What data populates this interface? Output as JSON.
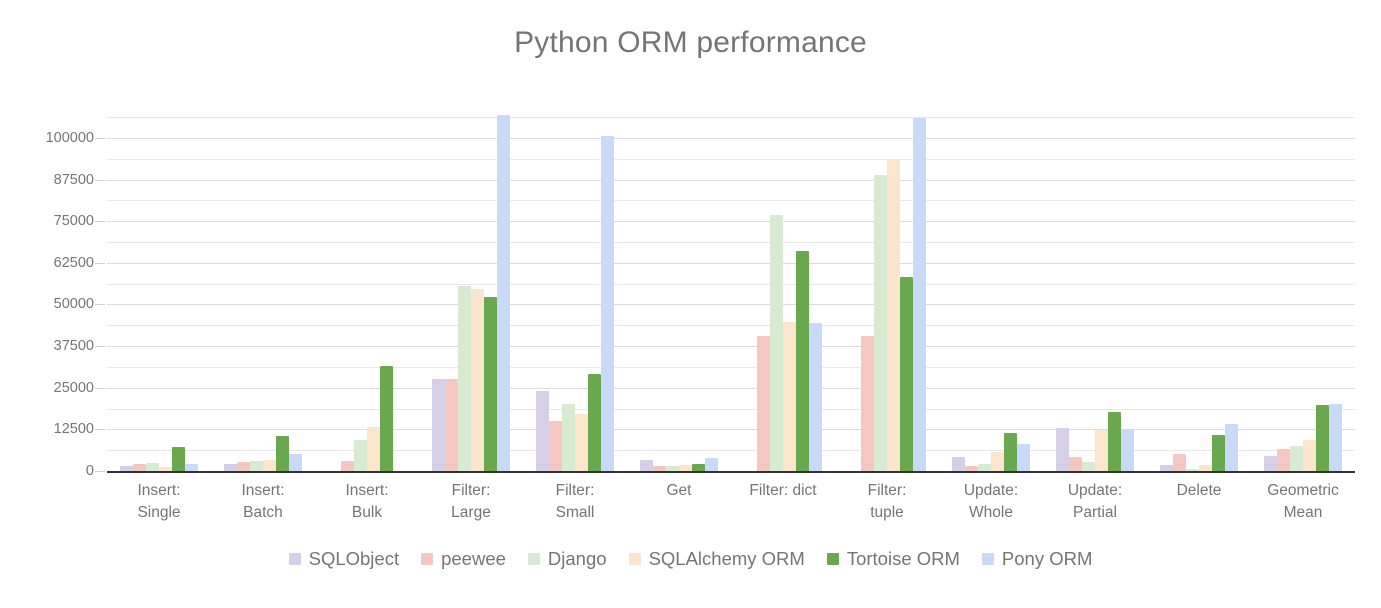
{
  "chart_data": {
    "type": "bar",
    "title": "Python ORM performance",
    "xlabel": "",
    "ylabel": "",
    "ylim": [
      0,
      112000
    ],
    "grid": true,
    "legend_position": "bottom",
    "y_ticks": [
      0,
      12500,
      25000,
      37500,
      50000,
      62500,
      75000,
      87500,
      100000
    ],
    "y_tick_labels": [
      "0",
      "12500",
      "25000",
      "37500",
      "50000",
      "62500",
      "75000",
      "87500",
      "100000"
    ],
    "y_minor_ticks": [
      6250,
      18750,
      31250,
      43750,
      56250,
      68750,
      81250,
      93750,
      106250
    ],
    "categories": [
      "Insert:\nSingle",
      "Insert:\nBatch",
      "Insert:\nBulk",
      "Filter:\nLarge",
      "Filter:\nSmall",
      "Get",
      "Filter: dict",
      "Filter:\ntuple",
      "Update:\nWhole",
      "Update:\nPartial",
      "Delete",
      "Geometric\nMean"
    ],
    "category_lines": [
      [
        "Insert:",
        "Single"
      ],
      [
        "Insert:",
        "Batch"
      ],
      [
        "Insert:",
        "Bulk"
      ],
      [
        "Filter:",
        "Large"
      ],
      [
        "Filter:",
        "Small"
      ],
      [
        "Get",
        ""
      ],
      [
        "Filter: dict",
        ""
      ],
      [
        "Filter:",
        "tuple"
      ],
      [
        "Update:",
        "Whole"
      ],
      [
        "Update:",
        "Partial"
      ],
      [
        "Delete",
        ""
      ],
      [
        "Geometric",
        "Mean"
      ]
    ],
    "series": [
      {
        "name": "SQLObject",
        "color": "#d5cfe8",
        "values": [
          1500,
          2200,
          0,
          27500,
          24000,
          3200,
          null,
          null,
          4200,
          13000,
          1800,
          4400
        ]
      },
      {
        "name": "peewee",
        "color": "#f4c7c3",
        "values": [
          2200,
          2800,
          3000,
          27700,
          15000,
          1500,
          40500,
          40600,
          1500,
          4200,
          5200,
          6500
        ]
      },
      {
        "name": "Django",
        "color": "#d9ead3",
        "values": [
          2300,
          2900,
          9200,
          55500,
          20000,
          1600,
          77000,
          89000,
          2000,
          2600,
          600,
          7600
        ]
      },
      {
        "name": "SQLAlchemy ORM",
        "color": "#fce5cd",
        "values": [
          1300,
          3300,
          13200,
          54700,
          17200,
          1700,
          44800,
          93500,
          5700,
          12300,
          1700,
          9300
        ]
      },
      {
        "name": "Tortoise ORM",
        "color": "#6aa84f",
        "values": [
          7200,
          10400,
          31500,
          52300,
          29200,
          2000,
          66000,
          58200,
          11500,
          17700,
          10800,
          19700
        ]
      },
      {
        "name": "Pony ORM",
        "color": "#c9daf8",
        "values": [
          2100,
          5200,
          0,
          107000,
          100500,
          3800,
          44300,
          106000,
          8200,
          12500,
          14000,
          20200
        ]
      }
    ]
  },
  "legend": {
    "items": [
      {
        "label": "SQLObject",
        "color": "#d5cfe8"
      },
      {
        "label": "peewee",
        "color": "#f4c7c3"
      },
      {
        "label": "Django",
        "color": "#d9ead3"
      },
      {
        "label": "SQLAlchemy ORM",
        "color": "#fce5cd"
      },
      {
        "label": "Tortoise ORM",
        "color": "#6aa84f"
      },
      {
        "label": "Pony ORM",
        "color": "#c9daf8"
      }
    ]
  },
  "colors": {
    "title": "#757575",
    "axis_text": "#757575",
    "gridline": "#e8e8e8",
    "axis_line": "#333333",
    "background": "#ffffff"
  }
}
